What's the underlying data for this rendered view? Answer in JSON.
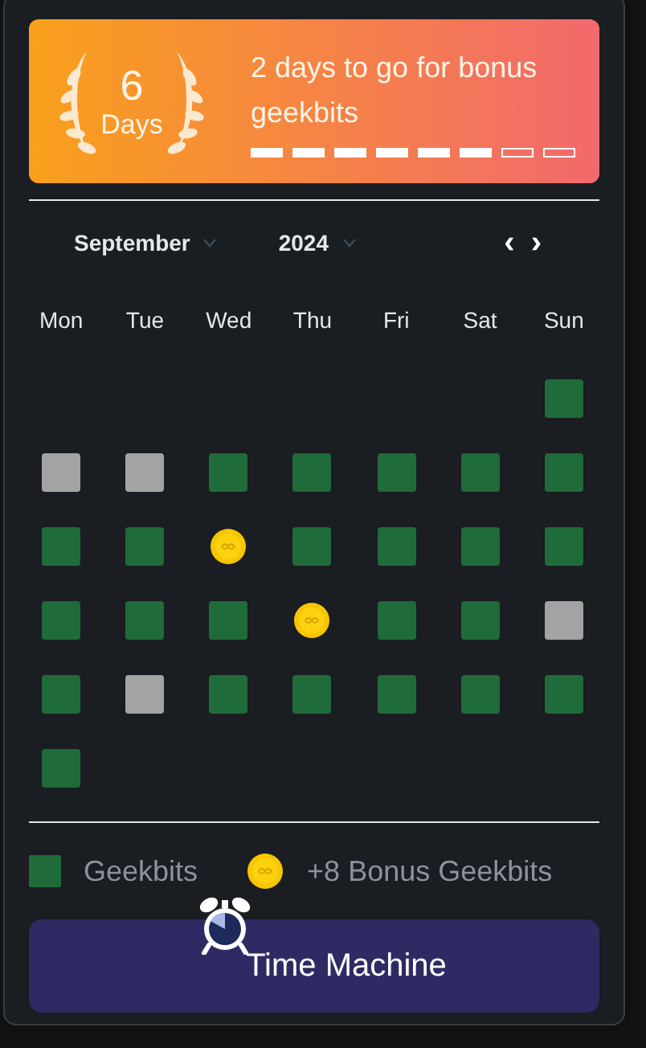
{
  "streak": {
    "count": "6",
    "unit": "Days",
    "message": "2 days to go for bonus geekbits",
    "segments": [
      {
        "filled": true
      },
      {
        "filled": true
      },
      {
        "filled": true
      },
      {
        "filled": true
      },
      {
        "filled": true
      },
      {
        "filled": true
      },
      {
        "filled": false
      },
      {
        "filled": false
      }
    ]
  },
  "calendar": {
    "month": "September",
    "year": "2024",
    "prev": "‹",
    "next": "›",
    "weekdays": [
      "Mon",
      "Tue",
      "Wed",
      "Thu",
      "Fri",
      "Sat",
      "Sun"
    ],
    "weeks": [
      [
        {
          "kind": "empty"
        },
        {
          "kind": "empty"
        },
        {
          "kind": "empty"
        },
        {
          "kind": "empty"
        },
        {
          "kind": "empty"
        },
        {
          "kind": "empty"
        },
        {
          "kind": "geekbit"
        }
      ],
      [
        {
          "kind": "missed"
        },
        {
          "kind": "missed"
        },
        {
          "kind": "geekbit"
        },
        {
          "kind": "geekbit"
        },
        {
          "kind": "geekbit"
        },
        {
          "kind": "geekbit"
        },
        {
          "kind": "geekbit"
        }
      ],
      [
        {
          "kind": "geekbit"
        },
        {
          "kind": "geekbit"
        },
        {
          "kind": "bonus"
        },
        {
          "kind": "geekbit"
        },
        {
          "kind": "geekbit"
        },
        {
          "kind": "geekbit"
        },
        {
          "kind": "geekbit"
        }
      ],
      [
        {
          "kind": "geekbit"
        },
        {
          "kind": "geekbit"
        },
        {
          "kind": "geekbit"
        },
        {
          "kind": "bonus"
        },
        {
          "kind": "geekbit"
        },
        {
          "kind": "geekbit"
        },
        {
          "kind": "missed"
        }
      ],
      [
        {
          "kind": "geekbit"
        },
        {
          "kind": "missed"
        },
        {
          "kind": "geekbit"
        },
        {
          "kind": "geekbit"
        },
        {
          "kind": "geekbit"
        },
        {
          "kind": "geekbit"
        },
        {
          "kind": "geekbit"
        }
      ],
      [
        {
          "kind": "geekbit"
        },
        {
          "kind": "empty"
        },
        {
          "kind": "empty"
        },
        {
          "kind": "empty"
        },
        {
          "kind": "empty"
        },
        {
          "kind": "empty"
        },
        {
          "kind": "empty"
        }
      ]
    ]
  },
  "legend": [
    {
      "kind": "geekbit",
      "label": "Geekbits"
    },
    {
      "kind": "bonus",
      "label": "+8 Bonus Geekbits"
    }
  ],
  "button": {
    "label": "Time Machine"
  }
}
